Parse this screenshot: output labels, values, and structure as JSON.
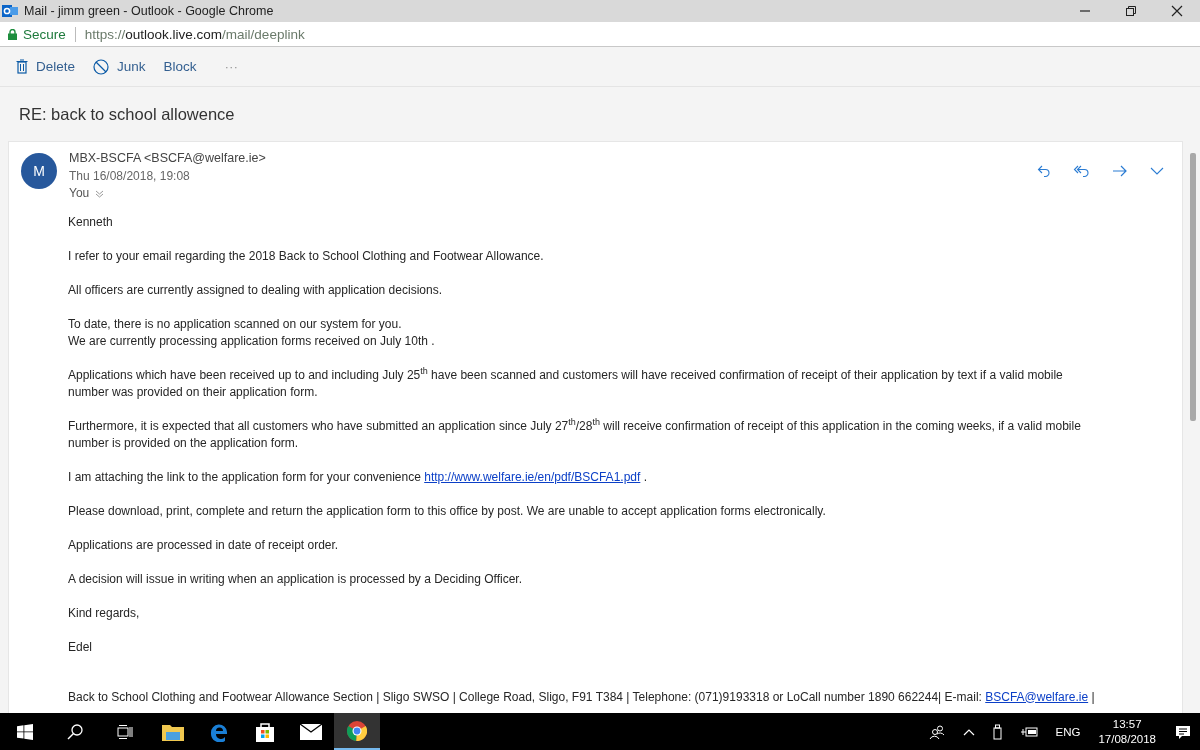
{
  "window": {
    "title": "Mail - jimm green - Outlook - Google Chrome"
  },
  "address_bar": {
    "security": "Secure",
    "url_scheme": "https://",
    "url_host": "outlook.live.com",
    "url_path": "/mail/deeplink"
  },
  "toolbar": [
    "Delete",
    "Junk",
    "Block",
    "···"
  ],
  "subject": "RE: back to school allowence",
  "message": {
    "avatar": "M",
    "sender": "MBX-BSCFA <BSCFA@welfare.ie>",
    "date": "Thu 16/08/2018, 19:08",
    "to": "You",
    "paragraphs": [
      {
        "kind": "text",
        "lines": [
          "Kenneth"
        ]
      },
      {
        "kind": "text",
        "lines": [
          "I refer to your email regarding the 2018 Back to School Clothing and Footwear Allowance."
        ]
      },
      {
        "kind": "text",
        "lines": [
          "All officers are currently assigned to dealing with application decisions."
        ]
      },
      {
        "kind": "text",
        "lines": [
          "To date, there is no application scanned on our system for you.",
          "We are currently processing application forms received on July 10th ."
        ]
      },
      {
        "kind": "text",
        "lines": [
          "Applications which have been received up to and including July 25$^{th}$  have been scanned and customers will have received confirmation  of receipt of their application by text if a valid mobile",
          "number was provided on their application form."
        ]
      },
      {
        "kind": "text",
        "lines": [
          "Furthermore, it is expected that all customers who have submitted an application since July 27$^{th}$/28$^{th}$  will receive confirmation of receipt of this application in the coming weeks, if a valid mobile",
          "number is provided on the application form."
        ]
      },
      {
        "kind": "link",
        "text": "I am attaching the link to the application form for your convenience",
        "link": "http://www.welfare.ie/en/pdf/BSCFA1.pdf",
        "after": "."
      },
      {
        "kind": "text",
        "lines": [
          "Please download, print, complete and return the application form to this office by post. We are unable to accept application forms electronically."
        ]
      },
      {
        "kind": "text",
        "lines": [
          "Applications are processed in date of receipt order."
        ]
      },
      {
        "kind": "text",
        "lines": [
          "A decision will issue in writing when an application is processed by a Deciding Officer."
        ]
      },
      {
        "kind": "text",
        "lines": [
          "Kind regards,"
        ]
      },
      {
        "kind": "text",
        "lines": [
          "Edel"
        ]
      }
    ],
    "footer": {
      "text": "Back to School Clothing and Footwear Allowance Section | Sligo SWSO | College Road, Sligo, F91 T384 | Telephone: (071)9193318 or LoCall number 1890 662244| E-mail:",
      "link": "BSCFA@welfare.ie",
      "after": "|"
    }
  },
  "taskbar": {
    "apps": [
      {
        "kind": "files",
        "selected": false
      },
      {
        "kind": "edge",
        "selected": false
      },
      {
        "kind": "store",
        "selected": false
      },
      {
        "kind": "mail",
        "selected": false
      },
      {
        "kind": "chrome",
        "selected": true
      }
    ],
    "language": "ENG",
    "time": "13:57",
    "date": "17/08/2018"
  }
}
